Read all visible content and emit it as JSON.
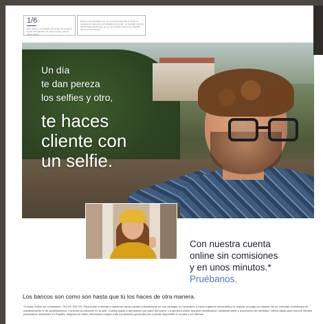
{
  "header": {
    "badge_number": "1/6",
    "badge_caption": "Este número es indicativo del riesgo del producto, siendo 1/6 indicativo de menor riesgo y 6/6 de mayor riesgo.",
    "guarantee_text": "BANCO SANTANDER, S.A. se encuentra adherido al Fondo de Garantía de Depósitos de Entidades de Crédito. La cantidad máxima garantizada actualmente por el mencionado fondo es de 100.000 euros por depositante."
  },
  "hero": {
    "intro": "Un día\nte dan pereza\nlos selfies y otro,",
    "headline": "te haces\ncliente con\nun selfie."
  },
  "offer": {
    "text": "Con nuestra cuenta\nonline sin comisiones\ny en unos minutos.*",
    "cta": "Pruébanos."
  },
  "footer": {
    "slogan": "Los bancos son como son hasta que tú los haces de otra manera.",
    "legal": "*Cuenta Online sin comisiones. TIN 0% TAE 0%. Para poder contratar y mantener dicha cuenta y beneficiarse de sus ventajas, es necesario: i) hacer ingresos mensuales y ii) realizar un pago con tarjeta. No se cobrarán comisiones de mantenimiento ni de administración. Consulta condiciones en la web. Cuenta sujeta a aprobación por parte del banco. La apertura online requiere identificación mediante selfie y documento de identidad. Oferta válida para nuevos clientes particulares residentes en España, mayores de edad. Información sujeta a las condiciones generales del contrato disponible en la web y en oficinas."
  }
}
